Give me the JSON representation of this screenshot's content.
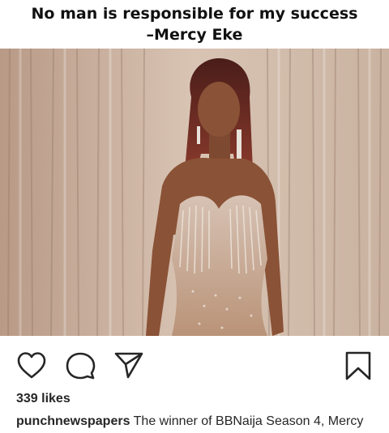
{
  "quote": {
    "line1": "No man is responsible for my success",
    "line2": "–Mercy Eke"
  },
  "photo": {
    "subject": "woman-in-sequin-gown",
    "colors": {
      "curtain_light": "#d9c4b4",
      "curtain_dark": "#a88d7b",
      "gown": "#c9a890",
      "skin": "#8a5236",
      "hair": "#6a2a22"
    }
  },
  "actions": {
    "like_icon": "heart-outline",
    "comment_icon": "speech-bubble-outline",
    "share_icon": "paper-plane-outline",
    "save_icon": "bookmark-outline"
  },
  "post": {
    "likes": "339 likes",
    "username": "punchnewspapers",
    "caption": "The winner of BBNaija Season 4, Mercy"
  }
}
